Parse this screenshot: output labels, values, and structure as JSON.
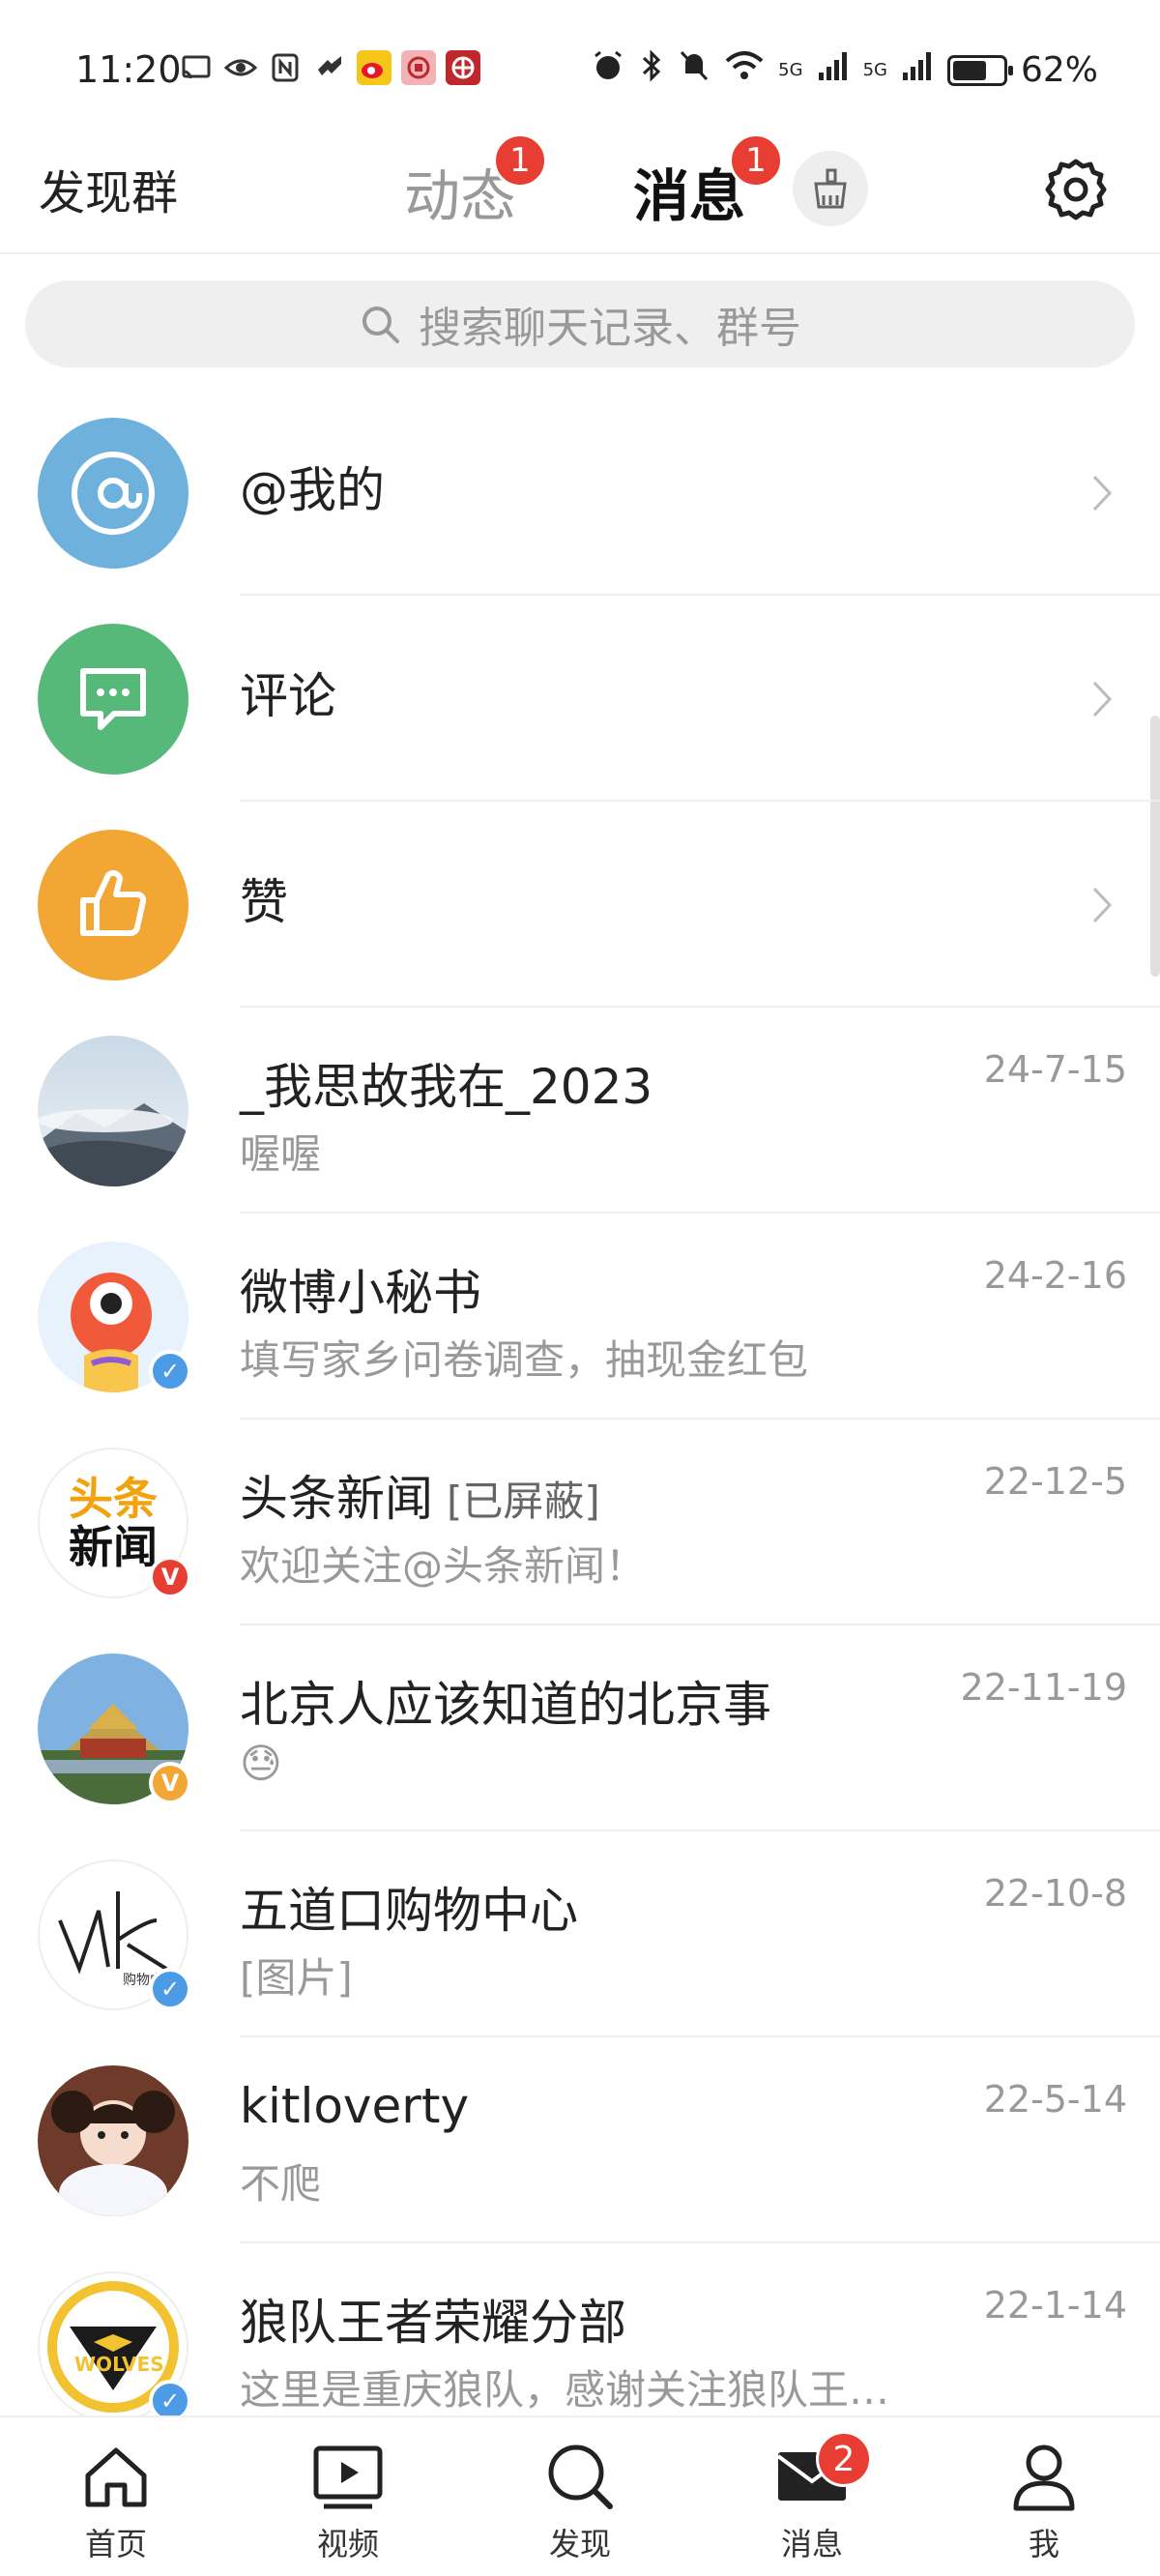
{
  "status_bar": {
    "time": "11:20",
    "battery": "62%",
    "signal_label_1": "5G",
    "signal_label_2": "5G"
  },
  "top_nav": {
    "discover_group": "发现群",
    "tab_dongtai": "动态",
    "tab_dongtai_badge": "1",
    "tab_xiaoxi": "消息",
    "tab_xiaoxi_badge": "1",
    "accent_color": "#f7a21d"
  },
  "search": {
    "placeholder": "搜索聊天记录、群号"
  },
  "shortcuts": [
    {
      "label": "@我的",
      "icon": "at-icon",
      "color": "#6fb1dd"
    },
    {
      "label": "评论",
      "icon": "comment-icon",
      "color": "#56b97a"
    },
    {
      "label": "赞",
      "icon": "thumbs-up-icon",
      "color": "#f2a634"
    }
  ],
  "chats": [
    {
      "name": "_我思故我在_2023",
      "blocked": "",
      "preview": "喔喔",
      "date": "24-7-15"
    },
    {
      "name": "微博小秘书",
      "blocked": "",
      "preview": "填写家乡问卷调查，抽现金红包",
      "date": "24-2-16"
    },
    {
      "name": "头条新闻",
      "blocked": "[已屏蔽]",
      "preview": "欢迎关注@头条新闻！",
      "date": "22-12-5",
      "logo_text_1": "头条",
      "logo_text_2": "新闻"
    },
    {
      "name": "北京人应该知道的北京事",
      "blocked": "",
      "preview": "😓",
      "date": "22-11-19"
    },
    {
      "name": "五道口购物中心",
      "blocked": "",
      "preview": "[图片]",
      "date": "22-10-8",
      "logo_text": "购物中"
    },
    {
      "name": "kitloverty",
      "blocked": "",
      "preview": "不爬",
      "date": "22-5-14"
    },
    {
      "name": "狼队王者荣耀分部",
      "blocked": "",
      "preview": "这里是重庆狼队，感谢关注狼队王…",
      "date": "22-1-14",
      "logo_text": "WOLVES"
    }
  ],
  "bottom_nav": [
    {
      "label": "首页",
      "icon": "home-icon"
    },
    {
      "label": "视频",
      "icon": "video-icon"
    },
    {
      "label": "发现",
      "icon": "search-icon"
    },
    {
      "label": "消息",
      "icon": "mail-icon",
      "badge": "2"
    },
    {
      "label": "我",
      "icon": "profile-icon"
    }
  ]
}
